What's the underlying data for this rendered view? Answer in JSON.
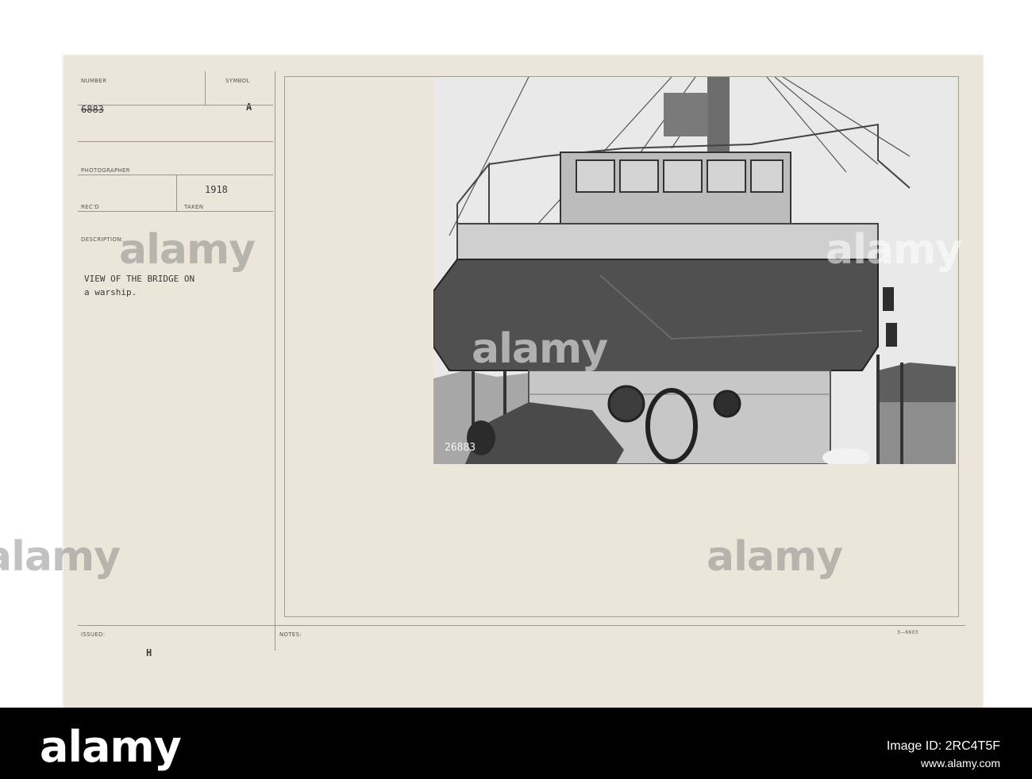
{
  "card": {
    "number_label": "NUMBER",
    "number_value": "6883",
    "symbol_label": "SYMBOL",
    "symbol_value": "A",
    "photographer_label": "PHOTOGRAPHER",
    "recd_label": "REC'D",
    "taken_label": "TAKEN",
    "taken_value": "1918",
    "description_label": "DESCRIPTION:",
    "description_line1": "VIEW OF THE BRIDGE ON",
    "description_line2": "a warship.",
    "issued_label": "ISSUED:",
    "issued_value": "H",
    "notes_label": "NOTES:",
    "form_code": "3—6603",
    "photo_number": "26883"
  },
  "watermarks": [
    "alamy",
    "alamy",
    "alamy",
    "alamy",
    "alamy"
  ],
  "footer": {
    "logo": "alamy",
    "image_id": "Image ID: 2RC4T5F",
    "site": "www.alamy.com"
  },
  "colors": {
    "card_bg": "#ece6da",
    "footer_bg": "#000000"
  }
}
